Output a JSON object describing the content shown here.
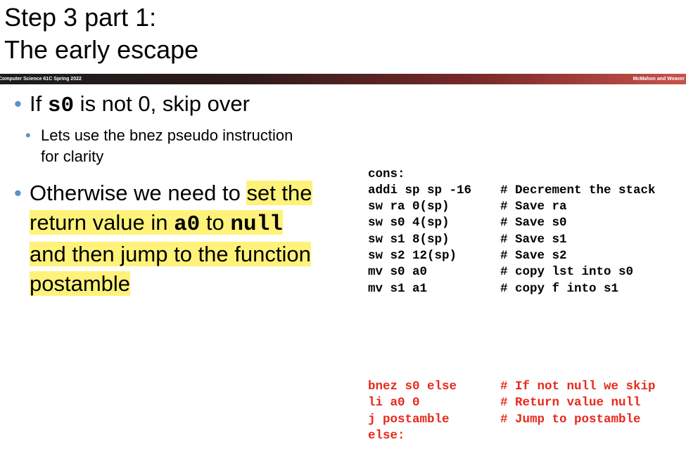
{
  "title": {
    "line1": "Step 3 part 1:",
    "line2": "The early escape"
  },
  "banner": {
    "left": "Computer Science 61C Spring 2022",
    "right": "McMahon and Weaver"
  },
  "bullets": {
    "b1_pre": "If ",
    "b1_code": "s0",
    "b1_post": " is not 0, skip over",
    "b2_line1": "Lets use the bnez pseudo instruction",
    "b2_line2": "for clarity",
    "b3_pre": "Otherwise we need to ",
    "b3_hl1": "set the",
    "b3_hl2a": "return value in ",
    "b3_code1": "a0",
    "b3_hl2b": " to ",
    "b3_code2": "null",
    "b3_hl3": "and then jump to the function",
    "b3_hl4": "postamble"
  },
  "code": {
    "black": [
      {
        "instr": "cons:",
        "comment": ""
      },
      {
        "instr": "addi sp sp -16",
        "comment": "# Decrement the stack"
      },
      {
        "instr": "sw ra 0(sp)",
        "comment": "# Save ra"
      },
      {
        "instr": "sw s0 4(sp)",
        "comment": "# Save s0"
      },
      {
        "instr": "sw s1 8(sp)",
        "comment": "# Save s1"
      },
      {
        "instr": "sw s2 12(sp)",
        "comment": "# Save s2"
      },
      {
        "instr": "mv s0 a0",
        "comment": "# copy lst into s0"
      },
      {
        "instr": "mv s1 a1",
        "comment": "# copy f into s1"
      }
    ],
    "red": [
      {
        "instr": "bnez s0 else",
        "comment": "# If not null we skip"
      },
      {
        "instr": "li a0 0",
        "comment": "# Return value null"
      },
      {
        "instr": "j postamble",
        "comment": "# Jump to postamble"
      },
      {
        "instr": "else:",
        "comment": ""
      }
    ]
  },
  "colors": {
    "highlight": "#fff27a",
    "bullet": "#5b8fd0",
    "code_red": "#e8291c"
  }
}
